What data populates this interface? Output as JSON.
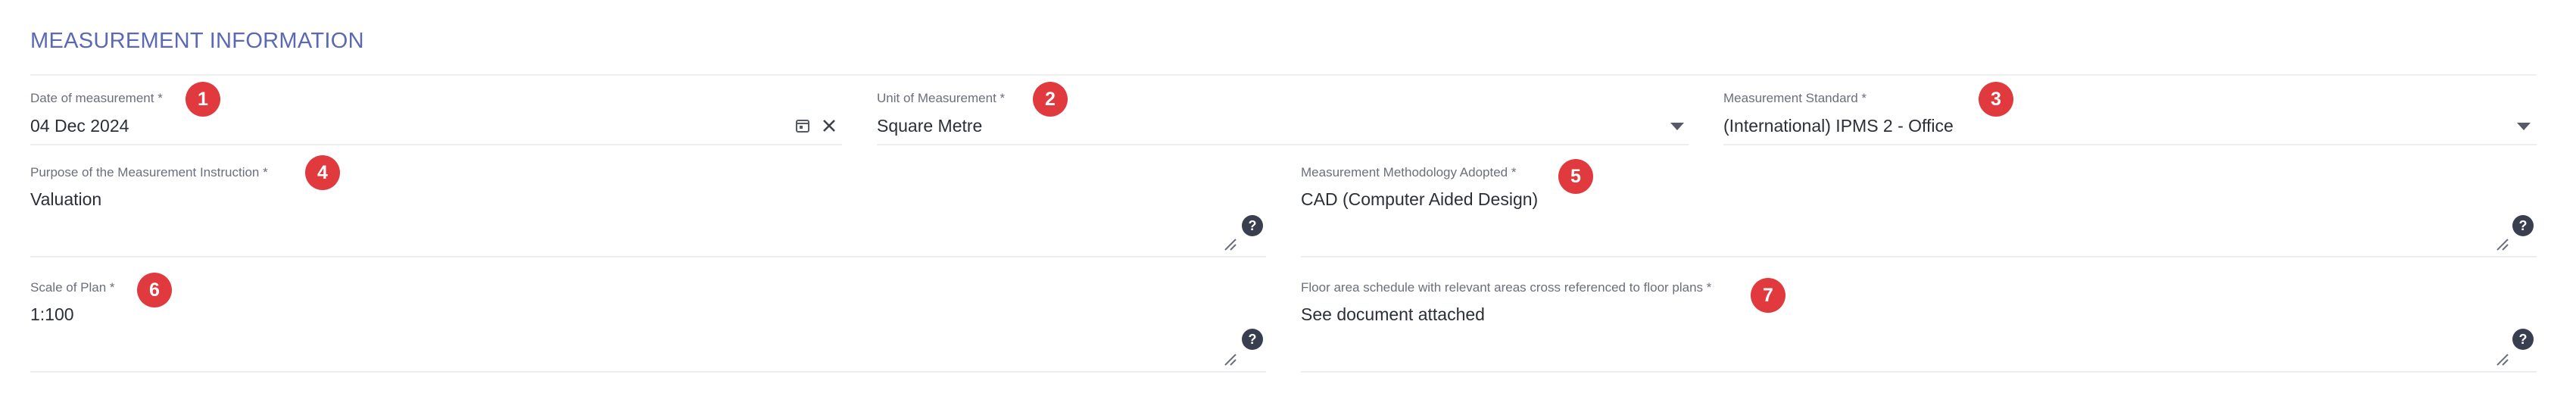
{
  "section": {
    "title": "MEASUREMENT INFORMATION"
  },
  "fields": {
    "date": {
      "label": "Date of measurement *",
      "value": "04 Dec 2024",
      "badge": "1"
    },
    "unit": {
      "label": "Unit of Measurement *",
      "value": "Square Metre",
      "badge": "2"
    },
    "standard": {
      "label": "Measurement Standard *",
      "value": "(International) IPMS 2 - Office",
      "badge": "3"
    },
    "purpose": {
      "label": "Purpose of the Measurement Instruction *",
      "value": "Valuation",
      "badge": "4"
    },
    "methodology": {
      "label": "Measurement Methodology Adopted *",
      "value": "CAD (Computer Aided Design)",
      "badge": "5"
    },
    "scale": {
      "label": "Scale of Plan *",
      "value": "1:100",
      "badge": "6"
    },
    "floor_schedule": {
      "label": "Floor area schedule with relevant areas cross referenced to floor plans *",
      "value": "See document attached",
      "badge": "7"
    }
  },
  "icons": {
    "help": "?",
    "help_name": "help-icon",
    "calendar_name": "calendar-icon",
    "clear_name": "clear-icon",
    "dropdown_name": "chevron-down-icon",
    "resize_name": "resize-handle-icon"
  },
  "colors": {
    "accent": "#5b69b5",
    "badge": "#e0393e",
    "help_icon": "#3a3f4f"
  }
}
